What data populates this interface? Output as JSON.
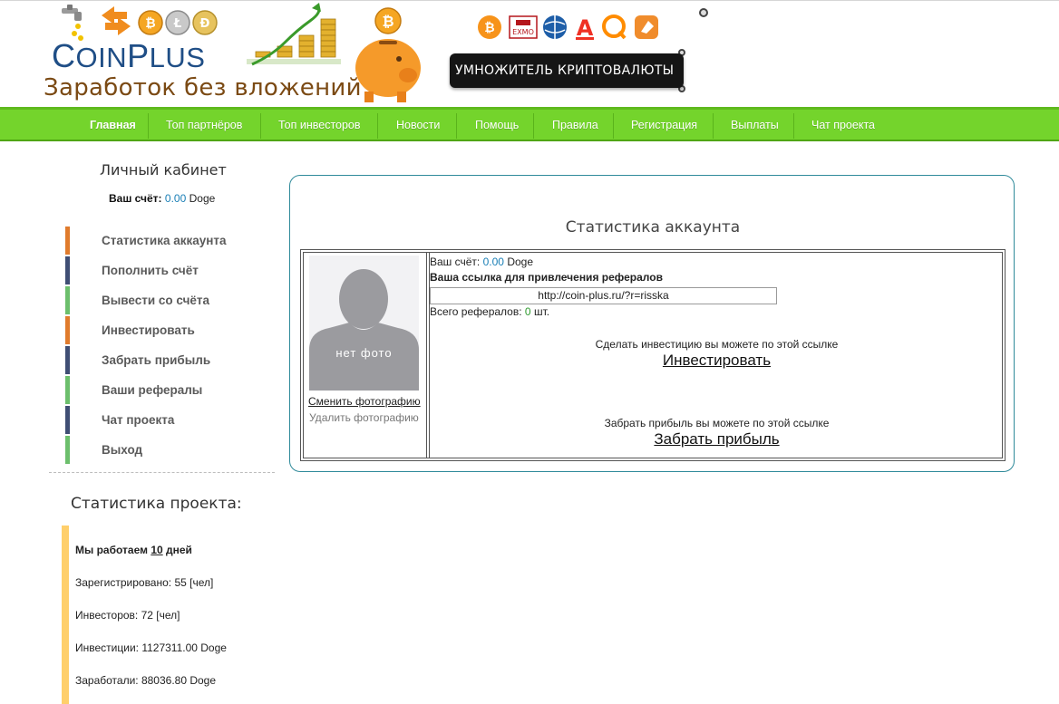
{
  "header": {
    "logo_text_part1": "C",
    "logo_text_part2": "OIN",
    "logo_text_part3": "P",
    "logo_text_part4": "LUS",
    "slogan": "Заработок без вложений",
    "multiplier_button": "УМНОЖИТЕЛЬ КРИПТОВАЛЮТЫ",
    "exchange_icons": [
      "bitcoin-icon",
      "exmo-icon",
      "webmoney-icon",
      "alfa-icon",
      "qiwi-icon",
      "yandex-icon"
    ],
    "exmo_label": "EXMO"
  },
  "nav": {
    "items": [
      "Главная",
      "Топ партнёров",
      "Топ инвесторов",
      "Новости",
      "Помощь",
      "Правила",
      "Регистрация",
      "Выплаты",
      "Чат проекта"
    ],
    "active_index": 0,
    "bg_color": "#74d42c"
  },
  "sidebar": {
    "title": "Личный кабинет",
    "balance_label": "Ваш счёт:",
    "balance_value": "0.00",
    "balance_unit": "Doge",
    "items": [
      {
        "label": "Статистика аккаунта",
        "color": "#e07b2c"
      },
      {
        "label": "Пополнить счёт",
        "color": "#3f4e74"
      },
      {
        "label": "Вывести со счёта",
        "color": "#6cbf6c"
      },
      {
        "label": "Инвестировать",
        "color": "#e07b2c"
      },
      {
        "label": "Забрать прибыль",
        "color": "#3f4e74"
      },
      {
        "label": "Ваши рефералы",
        "color": "#6cbf6c"
      },
      {
        "label": "Чат проекта",
        "color": "#3f4e74"
      },
      {
        "label": "Выход",
        "color": "#6cbf6c"
      }
    ]
  },
  "project_stats": {
    "title": "Статистика проекта:",
    "working_prefix": "Мы работаем",
    "working_days": "10",
    "working_suffix": "дней",
    "registered": "Зарегистрировано: 55 [чел]",
    "investors": "Инвесторов: 72 [чел]",
    "investments": "Инвестиции: 1127311.00 Doge",
    "earned": "Заработали: 88036.80 Doge"
  },
  "main": {
    "title": "Статистика аккаунта",
    "photo_text": "нет фото",
    "change_photo": "Сменить фотографию",
    "delete_photo": "Удалить фотографию",
    "balance_label": "Ваш счёт:",
    "balance_value": "0.00",
    "balance_unit": "Doge",
    "ref_link_label": "Ваша ссылка для привлечения рефералов",
    "ref_link_value": "http://coin-plus.ru/?r=risska",
    "referrals_label": "Всего рефералов:",
    "referrals_value": "0",
    "referrals_unit": "шт.",
    "invest_hint": "Сделать инвестицию вы можете по этой ссылке",
    "invest_link": "Инвестировать",
    "profit_hint": "Забрать прибыль вы можете по этой ссылке",
    "profit_link": "Забрать прибыль"
  }
}
